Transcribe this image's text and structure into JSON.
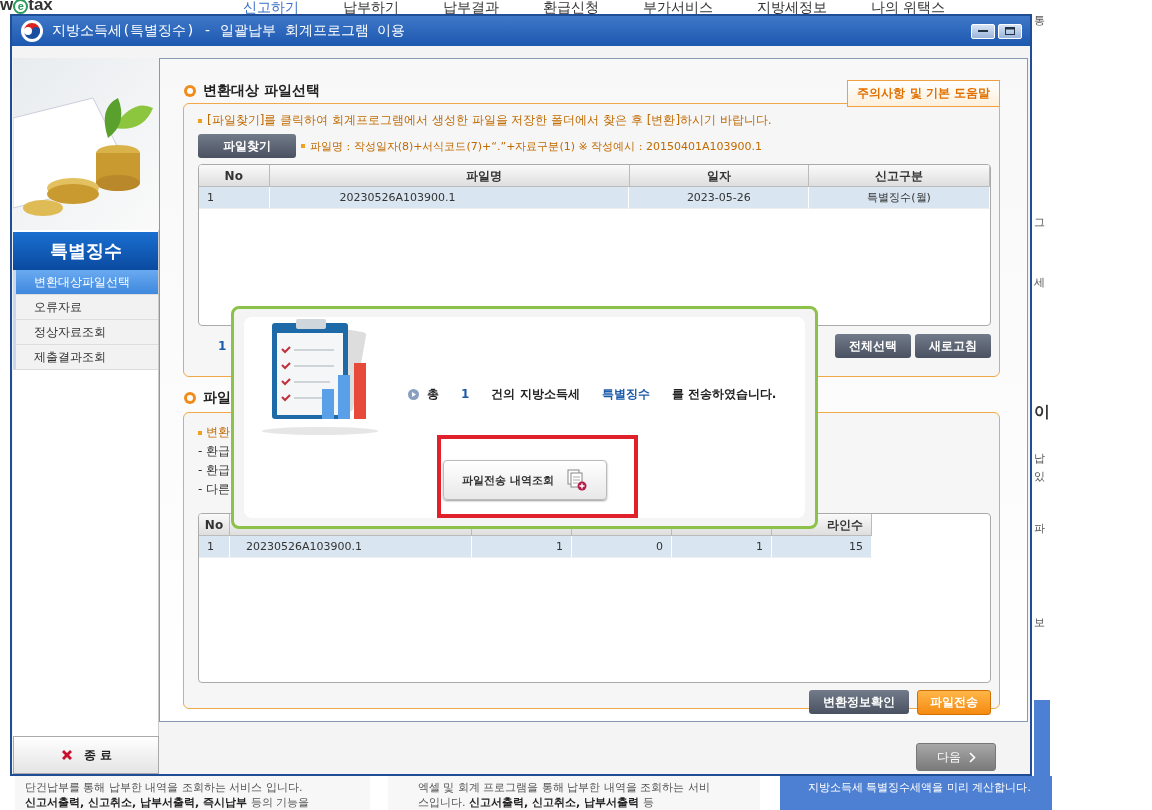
{
  "background": {
    "logo": {
      "before": "w",
      "circled": "e",
      "after": "tax"
    },
    "nav": [
      {
        "label": "신고하기",
        "selected": true
      },
      {
        "label": "납부하기",
        "selected": false
      },
      {
        "label": "납부결과",
        "selected": false
      },
      {
        "label": "환급신청",
        "selected": false
      },
      {
        "label": "부가서비스",
        "selected": false
      },
      {
        "label": "지방세정보",
        "selected": false
      },
      {
        "label": "나의 위택스",
        "selected": false
      }
    ],
    "edge_fragments": [
      "통",
      "그",
      "세",
      "이",
      "납",
      "있",
      "파",
      "보"
    ],
    "cards": [
      {
        "kind": "text",
        "lines": [
          "단건납부를 통해 납부한 내역을 조회하는 서비스 입니다.",
          "**신고서출력, 신고취소, 납부서출력, 즉시납부** 등의 기능을"
        ]
      },
      {
        "kind": "text",
        "lines": [
          "엑셀 및 회계 프로그램을 통해 납부한 내역을 조회하는 서비",
          "스입니다. **신고서출력, 신고취소, 납부서출력** 등"
        ]
      },
      {
        "kind": "banner",
        "lines": [
          "지방소득세 특별징수세액을 미리 계산합니다."
        ]
      }
    ]
  },
  "window": {
    "title": "지방소득세(특별징수) - 일괄납부 회계프로그램 이용"
  },
  "sidebar": {
    "heading": "특별징수",
    "items": [
      {
        "label": "변환대상파일선택",
        "selected": true
      },
      {
        "label": "오류자료",
        "selected": false
      },
      {
        "label": "정상자료조회",
        "selected": false
      },
      {
        "label": "제출결과조회",
        "selected": false
      }
    ],
    "exit_button": "종 료"
  },
  "section_1": {
    "title": "변환대상 파일선택",
    "help_button": "주의사항 및 기본 도움말",
    "notice": "[파일찾기]를 클릭하여 회계프로그램에서 생성한 파일을 저장한 폴더에서 찾은 후 [변환]하시기 바랍니다.",
    "find_button": "파일찾기",
    "file_hint": "파일명 : 작성일자(8)+서식코드(7)+“.”+자료구분(1)  ※ 작성예시 : 20150401A103900.1",
    "table": {
      "columns": [
        "No",
        "파일명",
        "일자",
        "신고구분"
      ],
      "rows": [
        {
          "selected": true,
          "cells": [
            "1",
            "20230526A103900.1",
            "2023-05-26",
            "특별징수(월)"
          ]
        }
      ]
    },
    "page": "1",
    "buttons": [
      "전체선택",
      "새로고침"
    ]
  },
  "section_2": {
    "title": "파일",
    "notes": [
      {
        "kind": "bullet",
        "text": "변환"
      },
      {
        "kind": "dash",
        "text": "- 환급"
      },
      {
        "kind": "dash",
        "text": "- 환급"
      },
      {
        "kind": "dash",
        "text": "- 다른"
      }
    ],
    "table": {
      "columns": {
        "first": "No",
        "last": "라인수"
      },
      "rows": [
        {
          "selected": true,
          "cells": [
            "1",
            "20230526A103900.1",
            "1",
            "0",
            "1",
            "15"
          ]
        }
      ]
    },
    "buttons": [
      {
        "label": "변환정보확인",
        "kind": "dark"
      },
      {
        "label": "파일전송",
        "kind": "orange"
      }
    ]
  },
  "dialog": {
    "message": [
      {
        "kind": "plain",
        "text": "총"
      },
      {
        "kind": "highlight",
        "text": "1"
      },
      {
        "kind": "plain",
        "text": "건의 지방소득세"
      },
      {
        "kind": "highlight",
        "text": "특별징수"
      },
      {
        "kind": "plain",
        "text": "를 전송하였습니다."
      }
    ],
    "button": "파일전송 내역조회",
    "highlighted": true
  },
  "next_button": "다음"
}
